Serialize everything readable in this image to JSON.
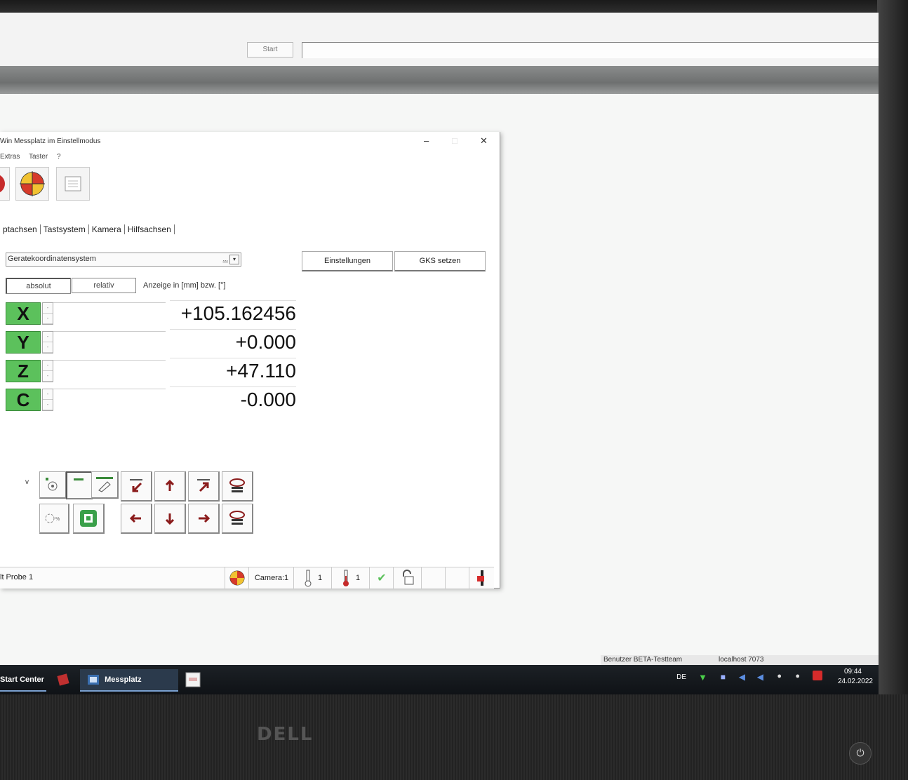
{
  "app": {
    "start_button": "Start"
  },
  "window": {
    "title": "Win Messplatz im Einstellmodus",
    "minimize": "–",
    "maximize": "□",
    "close": "✕",
    "menu": [
      "Extras",
      "Taster",
      "?"
    ],
    "tabs": [
      "ptachsen",
      "Tastsystem",
      "Kamera",
      "Hilfsachsen"
    ],
    "coord_system": "Geratekoordinatensystem",
    "coord_dots": "...",
    "einstellungen_label": "Einstellungen",
    "gks_label": "GKS setzen",
    "absolut_label": "absolut",
    "relativ_label": "relativ",
    "unit_text": "Anzeige in [mm] bzw. [°]",
    "axes": [
      {
        "letter": "X",
        "value": "+105.162456"
      },
      {
        "letter": "Y",
        "value": "+0.000"
      },
      {
        "letter": "Z",
        "value": "+47.110"
      },
      {
        "letter": "C",
        "value": "-0.000"
      }
    ],
    "status": {
      "probe": "lt Probe 1",
      "camera": "Camera:1",
      "temp1": "1",
      "temp2": "1"
    }
  },
  "statusbar": {
    "user": "Benutzer BETA-Testteam",
    "host": "localhost 7073"
  },
  "taskbar": {
    "start_center": "Start Center",
    "messplatz": "Messplatz",
    "lang": "DE",
    "time": "09:44",
    "date": "24.02.2022"
  },
  "monitor": {
    "brand": "DELL"
  },
  "colors": {
    "axis_green": "#5cc15c",
    "arrow_red": "#8b1c1c",
    "taskbar": "#1c2126"
  }
}
